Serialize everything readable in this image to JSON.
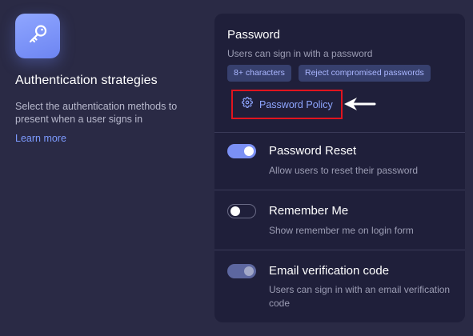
{
  "left": {
    "icon": "key-icon",
    "title": "Authentication strategies",
    "description": "Select the authentication methods to present when a user signs in",
    "learn_more": "Learn more"
  },
  "password": {
    "title": "Password",
    "subtitle": "Users can sign in with a password",
    "chips": [
      "8+ characters",
      "Reject compromised passwords"
    ],
    "policy_label": "Password Policy",
    "policy_icon": "gear-icon"
  },
  "options": [
    {
      "title": "Password Reset",
      "subtitle": "Allow users to reset their password",
      "state": "on"
    },
    {
      "title": "Remember Me",
      "subtitle": "Show remember me on login form",
      "state": "off"
    },
    {
      "title": "Email verification code",
      "subtitle": "Users can sign in with an email verification code",
      "state": "on-disabled"
    }
  ],
  "colors": {
    "background": "#2a2a45",
    "card": "#1f1f3a",
    "accent": "#7b90f5",
    "link": "#7d9bff",
    "highlight": "#e1141e"
  }
}
